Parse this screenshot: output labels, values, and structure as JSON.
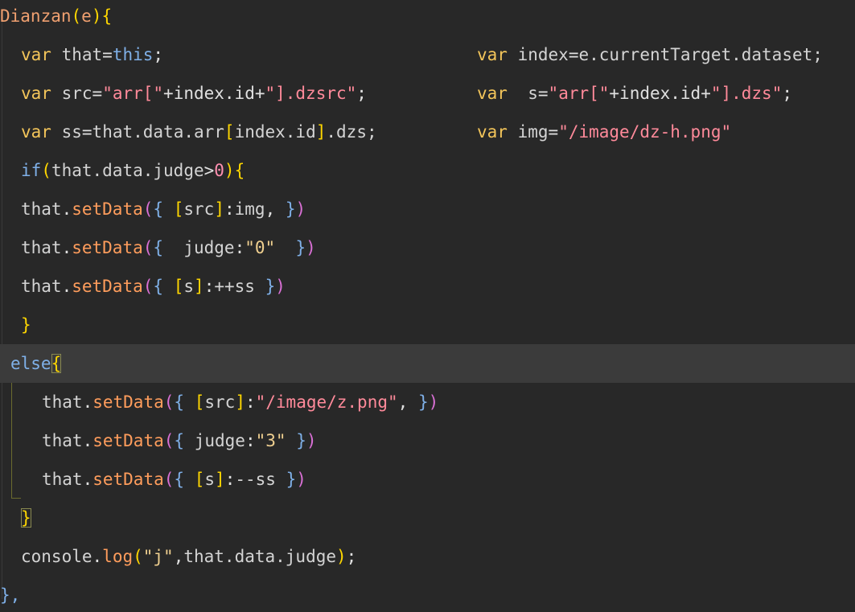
{
  "code": {
    "fn_name": "Dianzan",
    "param": "e",
    "kw_var": "var",
    "kw_if": "if",
    "kw_else": "else",
    "kw_this": "this",
    "ident_that": "that",
    "ident_src": "src",
    "ident_ss": "ss",
    "ident_index": "index",
    "ident_s": "s",
    "ident_img": "img",
    "m_setData": "setData",
    "m_log": "log",
    "ident_console": "console",
    "str_arr_open": "\"arr[\"",
    "str_dzsrc": "\"].dzsrc\"",
    "str_dzs": "\"].dzs\"",
    "str_img_h": "\"/image/dz-h.png\"",
    "str_img_z": "\"/image/z.png\"",
    "str_zero": "\"0\"",
    "str_three": "\"3\"",
    "str_j": "\"j\"",
    "num_zero": "0",
    "expr_index_id": "+index.id+",
    "expr_that_data_arr": "that.data.arr",
    "expr_index_id_plain": "index.id",
    "expr_dzs": ".dzs;",
    "expr_current_target": "e.currentTarget.dataset;",
    "expr_that_data_judge": "that.data.judge",
    "prop_judge": "judge",
    "op_incr": "++ss",
    "op_decr": "--ss",
    "close_fn": "},"
  }
}
